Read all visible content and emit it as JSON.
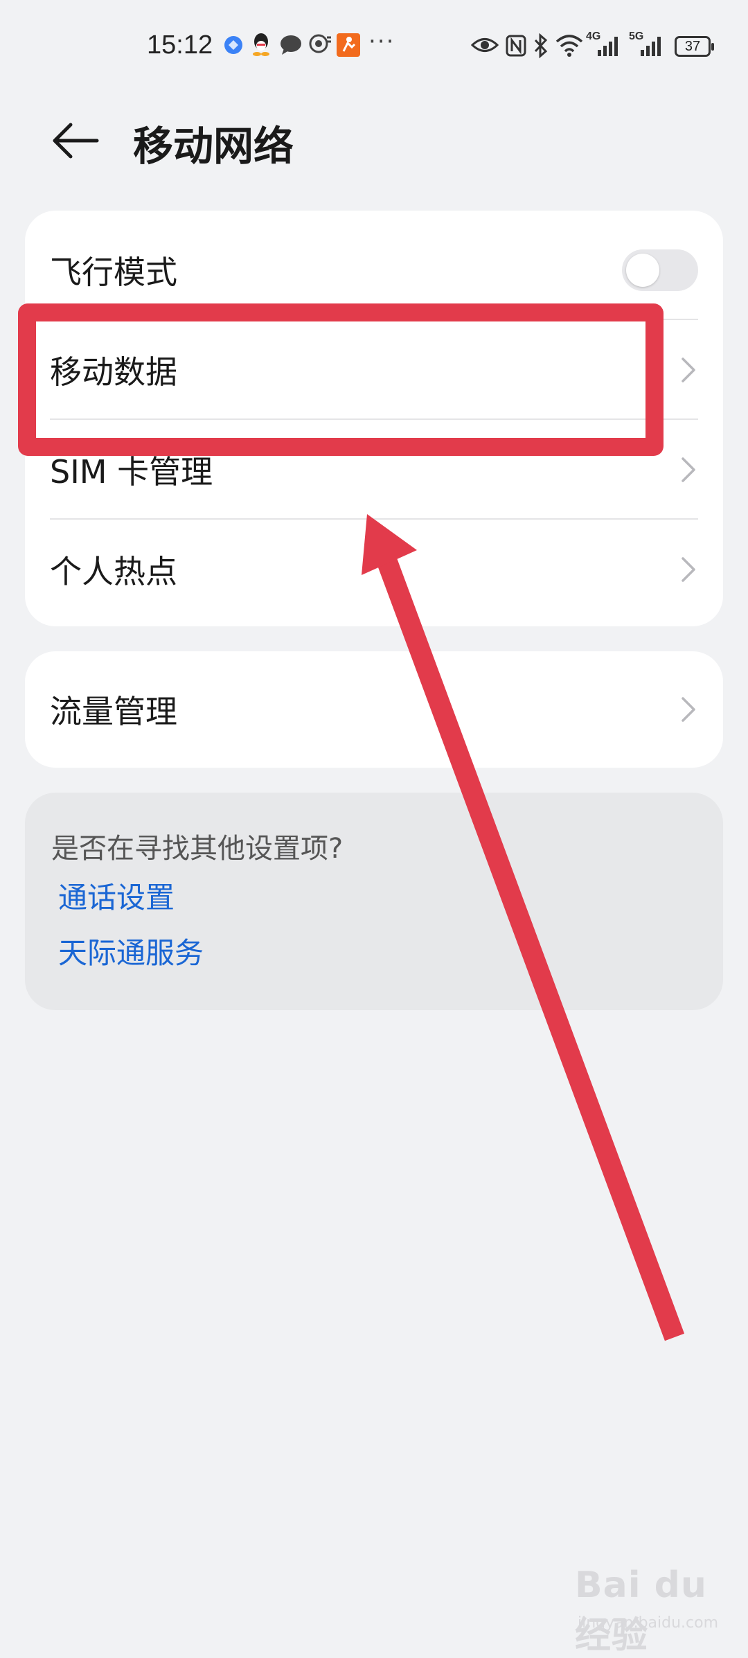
{
  "status_bar": {
    "time": "15:12",
    "notification_icons": [
      "browser-icon",
      "qq-icon",
      "message-icon",
      "location-icon",
      "app-icon"
    ],
    "more_indicator": "···",
    "network_4g": "4G",
    "network_5g": "5G",
    "battery": "37"
  },
  "header": {
    "title": "移动网络"
  },
  "settings": {
    "items": [
      {
        "label": "飞行模式",
        "toggle": false
      },
      {
        "label": "移动数据"
      },
      {
        "label": "SIM 卡管理"
      },
      {
        "label": "个人热点"
      }
    ],
    "traffic": {
      "label": "流量管理"
    }
  },
  "suggestions": {
    "question": "是否在寻找其他设置项?",
    "links": [
      "通话设置",
      "天际通服务"
    ]
  },
  "annotation": {
    "color": "#e23b4b"
  },
  "watermark": {
    "main": "Bai du 经验",
    "sub": "jingyan.baidu.com"
  }
}
